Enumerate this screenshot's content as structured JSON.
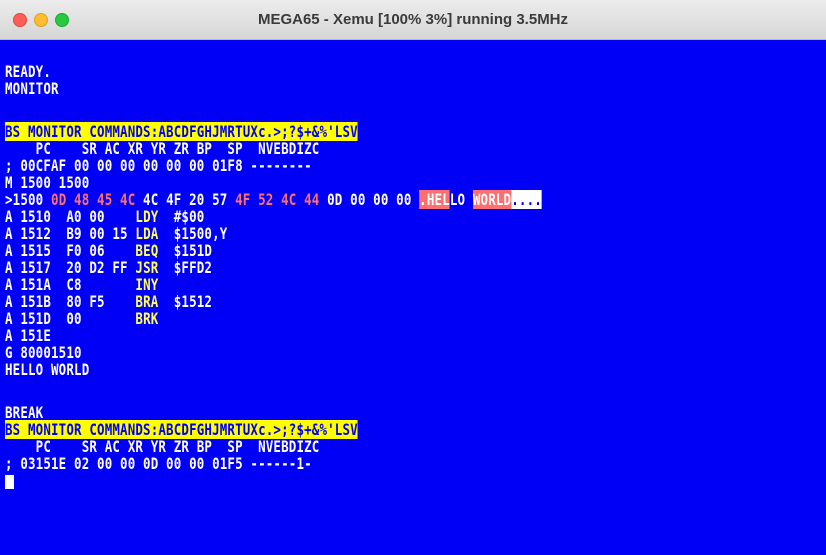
{
  "window": {
    "title": "MEGA65 - Xemu  [100% 3%] running 3.5MHz",
    "colors": {
      "screen_bg": "#0000f6",
      "text": "#ffffff",
      "opcode": "#ffff55",
      "hex_highlight": "#ff6f6f",
      "header_bg": "#ffff00"
    }
  },
  "screen": {
    "ready": "READY.",
    "monitor_cmd": "MONITOR",
    "header1": "BS MONITOR COMMANDS:ABCDFGHJMRTUXc.>;?$+&%'LSV",
    "reg_labels1": "    PC    SR AC XR YR ZR BP  SP  NVEBDIZC",
    "reg_values1": "; 00CFAF 00 00 00 00 00 00 01F8 --------",
    "mem_cmd": "M 1500 1500",
    "mem": {
      "prefix": ">1500 ",
      "bytes_hl1": "0D 48 45 4C ",
      "bytes_w1": "4C 4F 20 57 ",
      "bytes_hl2": "4F 52 4C 44 ",
      "bytes_w2": "0D 00 00 00 ",
      "ascii_a": ".HEL",
      "ascii_b": "LO ",
      "ascii_c": "WORLD",
      "ascii_d": "...."
    },
    "disasm": [
      {
        "addr": "A 1510  ",
        "bytes": "A0 00    ",
        "op": "LDY",
        "arg": "  #$00"
      },
      {
        "addr": "A 1512  ",
        "bytes": "B9 00 15 ",
        "op": "LDA",
        "arg": "  $1500,Y"
      },
      {
        "addr": "A 1515  ",
        "bytes": "F0 06    ",
        "op": "BEQ",
        "arg": "  $151D"
      },
      {
        "addr": "A 1517  ",
        "bytes": "20 D2 FF ",
        "op": "JSR",
        "arg": "  $FFD2"
      },
      {
        "addr": "A 151A  ",
        "bytes": "C8       ",
        "op": "INY",
        "arg": ""
      },
      {
        "addr": "A 151B  ",
        "bytes": "80 F5    ",
        "op": "BRA",
        "arg": "  $1512"
      },
      {
        "addr": "A 151D  ",
        "bytes": "00       ",
        "op": "BRK",
        "arg": ""
      }
    ],
    "line_a151e": "A 151E",
    "go_cmd": "G 80001510",
    "hello": "HELLO WORLD",
    "break": "BREAK",
    "header2": "BS MONITOR COMMANDS:ABCDFGHJMRTUXc.>;?$+&%'LSV",
    "reg_labels2": "    PC    SR AC XR YR ZR BP  SP  NVEBDIZC",
    "reg_values2": "; 03151E 02 00 00 0D 00 00 01F5 ------1-"
  }
}
